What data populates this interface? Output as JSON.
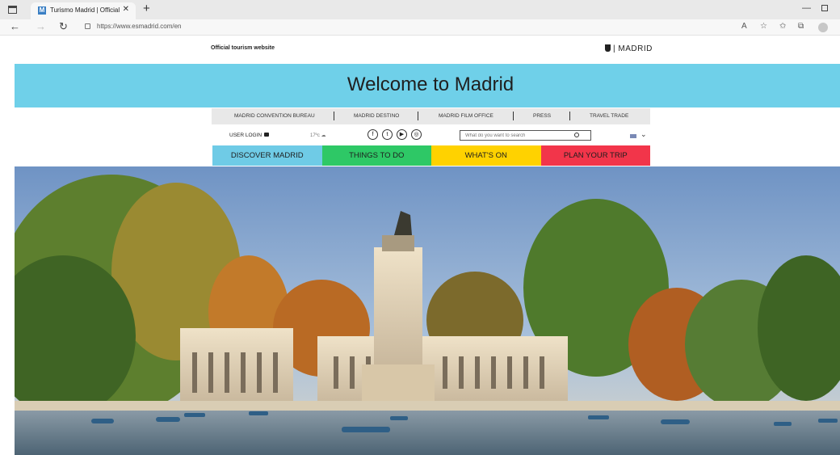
{
  "browser": {
    "tab_title": "Turismo Madrid | Official tourism",
    "tab_favicon": "M",
    "url": "https://www.esmadrid.com/en"
  },
  "header": {
    "official_label": "Official tourism website",
    "brand": "MADRID"
  },
  "welcome": {
    "title": "Welcome to Madrid",
    "background": "#6fd0e9"
  },
  "top_nav": [
    {
      "label": "MADRID CONVENTION BUREAU"
    },
    {
      "label": "MADRID DESTINO"
    },
    {
      "label": "MADRID FILM OFFICE"
    },
    {
      "label": "PRESS"
    },
    {
      "label": "TRAVEL TRADE"
    }
  ],
  "utility": {
    "user_login": "USER LOGIN",
    "weather": "17ºc",
    "social_icons": [
      "facebook-icon",
      "twitter-icon",
      "youtube-icon",
      "instagram-icon"
    ],
    "search_placeholder": "What do you want to search",
    "language_icon": "uk-flag-icon"
  },
  "categories": [
    {
      "label": "DISCOVER MADRID",
      "color": "#6fcbe6"
    },
    {
      "label": "THINGS TO DO",
      "color": "#2ec866"
    },
    {
      "label": "WHAT'S ON",
      "color": "#ffd200"
    },
    {
      "label": "PLAN YOUR TRIP",
      "color": "#f2354a"
    }
  ]
}
